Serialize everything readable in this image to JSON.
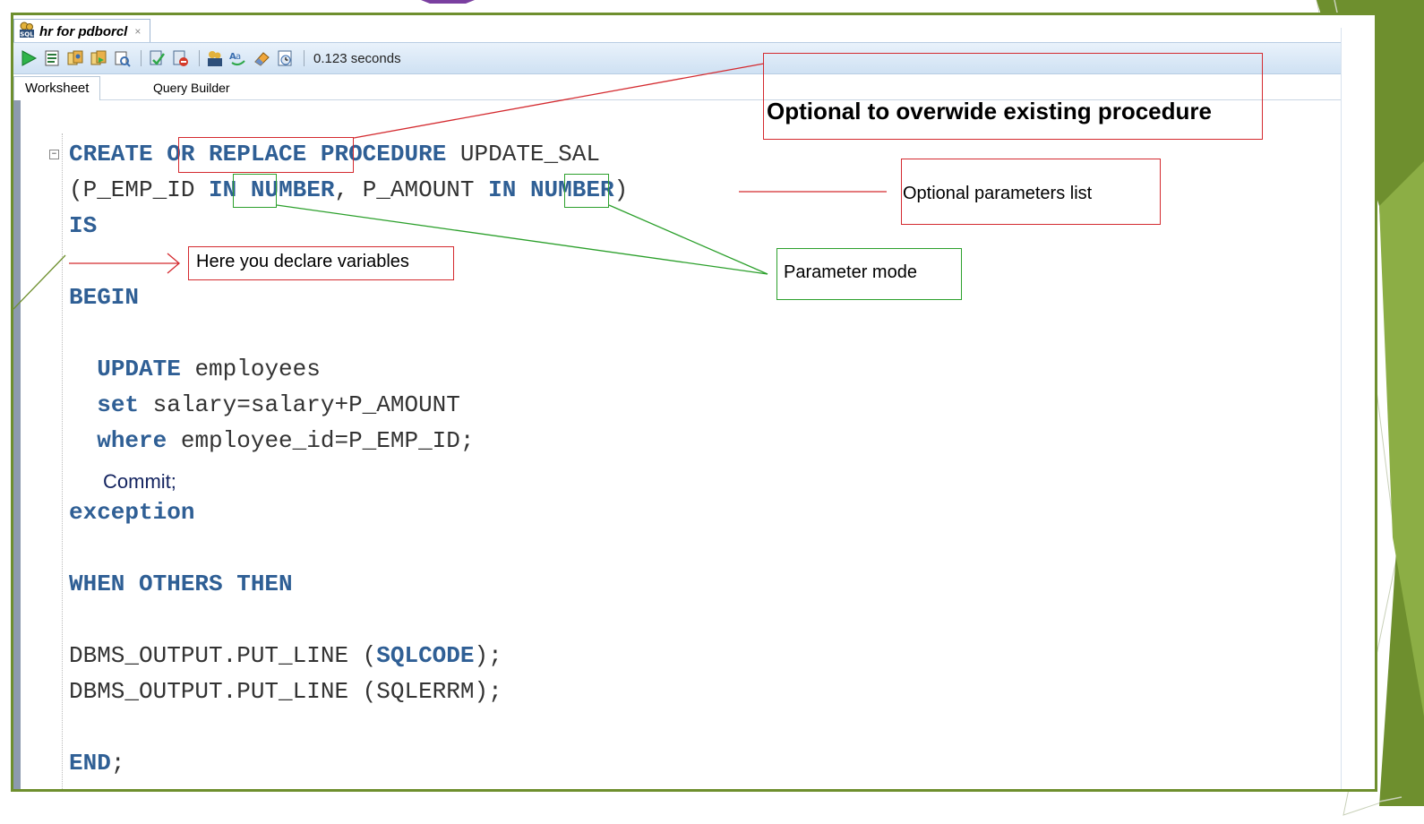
{
  "document_tab": {
    "label": "hr for pdborcl",
    "close": "×"
  },
  "toolbar": {
    "elapsed": "0.123 seconds"
  },
  "sub_tabs": [
    {
      "label": "Worksheet"
    },
    {
      "label": "Query Builder"
    }
  ],
  "code": {
    "l1_create": "CREATE",
    "l1_or_replace": "OR REPLACE",
    "l1_procedure": "PROCEDURE",
    "l1_name": "UPDATE_SAL",
    "l2_open": "(P_EMP_ID ",
    "l2_in1": "IN",
    "l2_number1": "NUMBER",
    "l2_mid": ", P_AMOUNT ",
    "l2_in2": "IN",
    "l2_number2": "NUMBER",
    "l2_close": ")",
    "l3_is": "IS",
    "l5_begin": "BEGIN",
    "l7_update": "UPDATE",
    "l7_rest": " employees",
    "l8_set": "set",
    "l8_rest": " salary=salary+P_AMOUNT",
    "l9_where": "where",
    "l9_rest": " employee_id=P_EMP_ID;",
    "commit": "Commit;",
    "l11_exception": "exception",
    "l13_when": "WHEN OTHERS THEN",
    "l15_a": "DBMS_OUTPUT.PUT_LINE (",
    "l15_sqlcode": "SQLCODE",
    "l15_b": ");",
    "l16": "DBMS_OUTPUT.PUT_LINE (SQLERRM);",
    "l18_end": "END",
    "l18_semi": ";"
  },
  "annotations": {
    "overwide": "Optional to overwide existing procedure",
    "params": "Optional parameters list",
    "declare": "Here you declare variables",
    "mode": "Parameter mode"
  },
  "colors": {
    "frame": "#6e8f2e",
    "keyword": "#2f5f95",
    "annotation_red": "#d42a2f",
    "annotation_green": "#2ca02c",
    "commit": "#13235f"
  }
}
